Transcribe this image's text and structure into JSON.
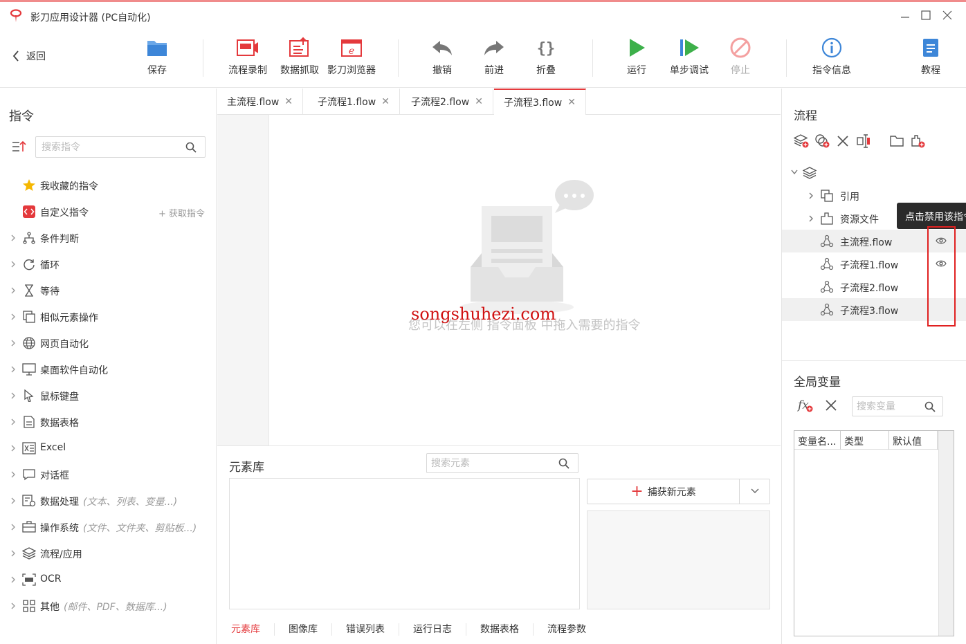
{
  "window": {
    "title": "影刀应用设计器 (PC自动化)",
    "accent": "#e4393c"
  },
  "toolbar": {
    "back_label": "返回",
    "buttons": [
      {
        "label": "保存",
        "icon": "save-icon"
      },
      {
        "label": "流程录制",
        "icon": "record-icon"
      },
      {
        "label": "数据抓取",
        "icon": "data-scrape-icon"
      },
      {
        "label": "影刀浏览器",
        "icon": "browser-icon"
      },
      {
        "label": "撤销",
        "icon": "undo-icon"
      },
      {
        "label": "前进",
        "icon": "redo-icon"
      },
      {
        "label": "折叠",
        "icon": "fold-icon"
      },
      {
        "label": "运行",
        "icon": "run-icon"
      },
      {
        "label": "单步调试",
        "icon": "step-debug-icon"
      },
      {
        "label": "停止",
        "icon": "stop-icon",
        "disabled": true
      },
      {
        "label": "指令信息",
        "icon": "info-icon"
      },
      {
        "label": "教程",
        "icon": "tutorial-icon"
      }
    ]
  },
  "commands": {
    "title": "指令",
    "search_placeholder": "搜索指令",
    "get_commands_label": "+ 获取指令",
    "items": [
      {
        "label": "我收藏的指令",
        "hint": "",
        "icon": "star-icon"
      },
      {
        "label": "自定义指令",
        "hint": "",
        "icon": "custom-command-icon"
      },
      {
        "label": "条件判断",
        "hint": "",
        "icon": "branch-icon"
      },
      {
        "label": "循环",
        "hint": "",
        "icon": "loop-icon"
      },
      {
        "label": "等待",
        "hint": "",
        "icon": "hourglass-icon"
      },
      {
        "label": "相似元素操作",
        "hint": "",
        "icon": "similar-elements-icon"
      },
      {
        "label": "网页自动化",
        "hint": "",
        "icon": "globe-icon"
      },
      {
        "label": "桌面软件自动化",
        "hint": "",
        "icon": "desktop-icon"
      },
      {
        "label": "鼠标键盘",
        "hint": "",
        "icon": "cursor-icon"
      },
      {
        "label": "数据表格",
        "hint": "",
        "icon": "sheet-icon"
      },
      {
        "label": "Excel",
        "hint": "",
        "icon": "excel-icon"
      },
      {
        "label": "对话框",
        "hint": "",
        "icon": "dialog-icon"
      },
      {
        "label": "数据处理",
        "hint": "(文本、列表、变量...)",
        "icon": "data-process-icon"
      },
      {
        "label": "操作系统",
        "hint": "(文件、文件夹、剪贴板...)",
        "icon": "os-icon"
      },
      {
        "label": "流程/应用",
        "hint": "",
        "icon": "layers-icon"
      },
      {
        "label": "OCR",
        "hint": "",
        "icon": "ocr-icon"
      },
      {
        "label": "其他",
        "hint": "(邮件、PDF、数据库...)",
        "icon": "grid-icon"
      }
    ]
  },
  "editor": {
    "tabs": [
      {
        "label": "主流程.flow",
        "active": false
      },
      {
        "label": "子流程1.flow",
        "active": false
      },
      {
        "label": "子流程2.flow",
        "active": false
      },
      {
        "label": "子流程3.flow",
        "active": true
      }
    ],
    "empty_hint": "您可以在左侧 指令面板 中拖入需要的指令",
    "watermark": "songshuhezi.com"
  },
  "element_library": {
    "title": "元素库",
    "search_placeholder": "搜索元素",
    "capture_label": "捕获新元素",
    "bottom_tabs": [
      "元素库",
      "图像库",
      "错误列表",
      "运行日志",
      "数据表格",
      "流程参数"
    ],
    "active_bottom_tab": "元素库"
  },
  "flow_panel": {
    "title": "流程",
    "tree": [
      {
        "label": "引用",
        "type": "folder"
      },
      {
        "label": "资源文件",
        "type": "folder"
      },
      {
        "label": "主流程.flow",
        "type": "flow",
        "eye": true
      },
      {
        "label": "子流程1.flow",
        "type": "flow",
        "eye": true
      },
      {
        "label": "子流程2.flow",
        "type": "flow",
        "eye": false
      },
      {
        "label": "子流程3.flow",
        "type": "flow",
        "eye": false
      }
    ],
    "tooltip": "点击禁用该指令"
  },
  "global_vars": {
    "title": "全局变量",
    "search_placeholder": "搜索变量",
    "columns": [
      "变量名...",
      "类型",
      "默认值"
    ]
  }
}
